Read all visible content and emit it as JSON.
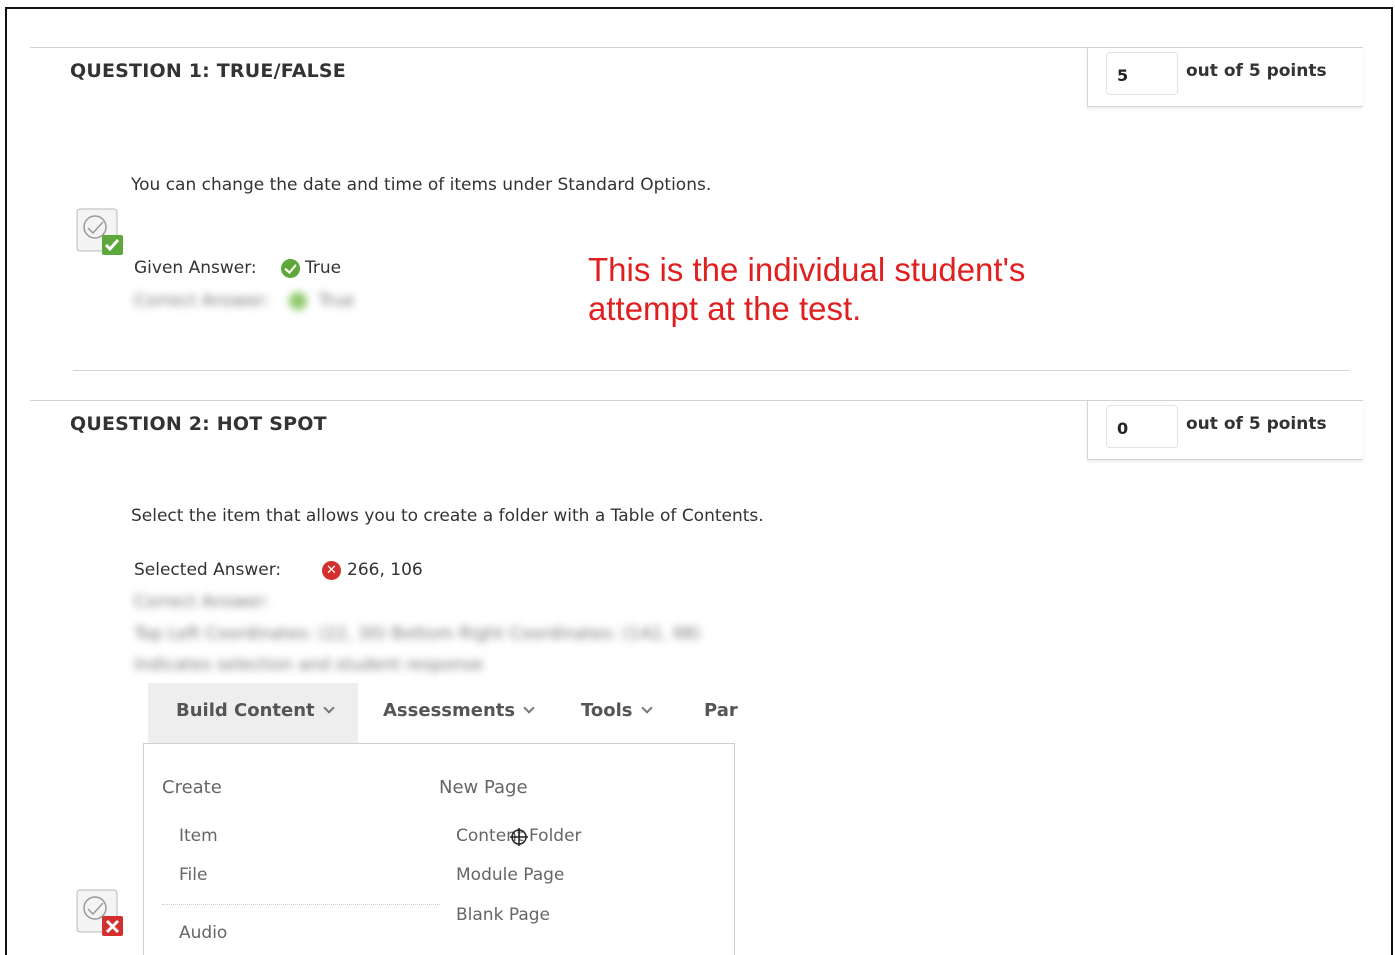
{
  "question1": {
    "title": "QUESTION 1:   TRUE/FALSE",
    "score": "5",
    "points_label": "out of 5 points",
    "text": "You can change the date and time of items under Standard Options.",
    "given_answer_label": "Given Answer:",
    "given_answer_value": "True",
    "correct_answer_label": "Correct Answer:",
    "correct_answer_value": "True",
    "status": "correct"
  },
  "annotation": {
    "line1": "This is the individual student's",
    "line2": "attempt at the test."
  },
  "question2": {
    "title": "QUESTION 2:   HOT SPOT",
    "score": "0",
    "points_label": "out of 5 points",
    "text": "Select the item that allows you to create a folder with a Table of Contents.",
    "selected_answer_label": "Selected Answer:",
    "selected_answer_value": "266, 106",
    "correct_answer_label": "Correct Answer:",
    "correct_coords_line": "Top Left Coordinates:   (22, 30)   Bottom Right Coordinates: (142, 98)",
    "indicator_line": "Indicates selection and student response",
    "status": "incorrect"
  },
  "hotspot_image": {
    "tabs": [
      {
        "label": "Build Content"
      },
      {
        "label": "Assessments"
      },
      {
        "label": "Tools"
      },
      {
        "label": "Par"
      }
    ],
    "dropdown": {
      "create_header": "Create",
      "new_page_header": "New Page",
      "create_items": [
        "Item",
        "File",
        "Audio"
      ],
      "new_page_items": [
        "Content Folder",
        "Module Page",
        "Blank Page"
      ]
    }
  },
  "colors": {
    "annotation": "#e02020",
    "correct": "#5da83a",
    "incorrect": "#d32f2f"
  }
}
